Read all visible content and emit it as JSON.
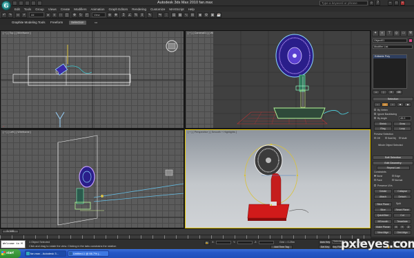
{
  "window": {
    "title": "Autodesk 3ds Max  2010      fan.max",
    "search_placeholder": "Type a keyword or phrase"
  },
  "menu": [
    "Edit",
    "Tools",
    "Group",
    "Views",
    "Create",
    "Modifiers",
    "Animation",
    "Graph Editors",
    "Rendering",
    "Customize",
    "MAXScript",
    "Help"
  ],
  "toolbar": {
    "selection_filter": "All",
    "view_mode": "View",
    "snap_value": "3"
  },
  "ribbon": {
    "tabs": [
      "Graphite Modeling Tools",
      "Freeform",
      "Selection"
    ],
    "active_tab": "Selection"
  },
  "viewports": {
    "top": "[ + ] [ Top ] [ Wireframe ]",
    "camera": "[ + ] [ Camera01 ] [ Wireframe ]",
    "left": "[ + ] [ Left ] [ Wireframe ]",
    "perspective": "[ + ] [ Perspective ] [ Smooth + Highlights ]"
  },
  "command_panel": {
    "object_name": "Object01",
    "modifier_list": "Modifier List",
    "stack_item": "Editable Poly",
    "selection_title": "Selection",
    "by_vertex": "By Vertex",
    "ignore_backfacing": "Ignore Backfacing",
    "by_angle": "By Angle",
    "angle_value": "45.0",
    "shrink": "Shrink",
    "grow": "Grow",
    "ring": "Ring",
    "loop": "Loop",
    "preview_selection": "Preview Selection",
    "off": "Off",
    "subobj": "SubObj",
    "multi": "Multi",
    "whole_selected": "Whole Object Selected",
    "soft_selection": "Soft Selection",
    "edit_geometry": "Edit Geometry",
    "repeat_last": "Repeat Last",
    "constraints": "Constraints",
    "none": "None",
    "edge": "Edge",
    "face": "Face",
    "normal": "Normal",
    "preserve_uvs": "Preserve UVs",
    "create": "Create",
    "collapse": "Collapse",
    "attach": "Attach",
    "detach": "Detach",
    "slice_plane": "Slice Plane",
    "split": "Split",
    "slice": "Slice",
    "reset_plane": "Reset Plane",
    "quickslice": "QuickSlice",
    "cut": "Cut",
    "msmooth": "MSmooth",
    "tessellate": "Tessellate",
    "make_planar": "Make Planar",
    "x": "X",
    "y": "Y",
    "z": "Z",
    "view_align": "View Align",
    "grid_align": "Grid Align"
  },
  "timeline": {
    "slider": "0 / 100"
  },
  "status": {
    "maxscript": "Welcome to M",
    "selected": "1 Object Selected",
    "prompt": "Click and drag to rotate the view.  Clicking in the tabs constrains the rotation",
    "x": "X:",
    "y": "Y:",
    "z": "Z:",
    "grid": "Grid = 0.25m",
    "add_time_tag": "Add Time Tag",
    "autokey": "Auto Key",
    "selected_mode": "Selected",
    "set_key": "Set Key",
    "key_filters": "Key Filters...",
    "frame": "0"
  },
  "taskbar": {
    "start": "start",
    "items": [
      "fan.max - Autodesk 3...",
      "Untitled-1 @ 66.7% (..."
    ]
  },
  "watermark": "pxleyes.com"
}
